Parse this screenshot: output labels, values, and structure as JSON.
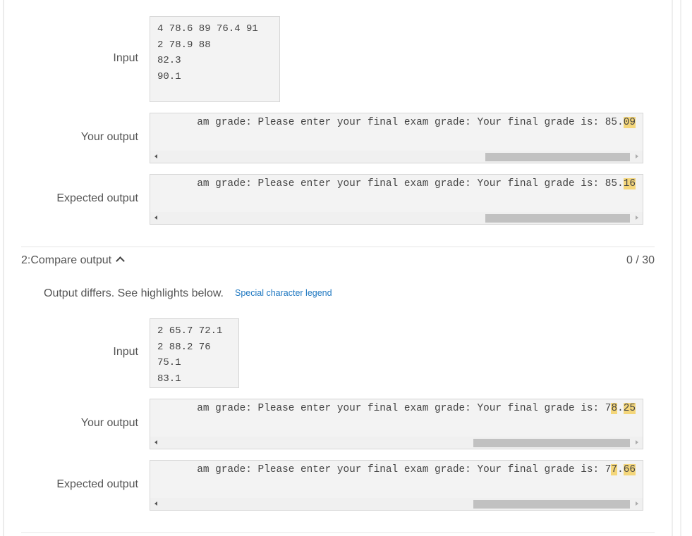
{
  "tests": [
    {
      "input": {
        "label": "Input",
        "value": "4 78.6 89 76.4 91\n2 78.9 88\n82.3\n90.1"
      },
      "your_output": {
        "label": "Your output",
        "prefix": "am grade: Please enter your final exam grade: Your final grade is: 85.",
        "diffs": [
          "09"
        ]
      },
      "expected_output": {
        "label": "Expected output",
        "prefix": "am grade: Please enter your final exam grade: Your final grade is: 85.",
        "diffs": [
          "16"
        ]
      }
    },
    {
      "header": {
        "title": "2:Compare output",
        "score": "0 / 30"
      },
      "message": "Output differs. See highlights below.",
      "legend_link": "Special character legend",
      "input": {
        "label": "Input",
        "value": "2 65.7 72.1\n2 88.2 76\n75.1\n83.1"
      },
      "your_output": {
        "label": "Your output",
        "prefix": "am grade: Please enter your final exam grade: Your final grade is: 7",
        "diff1": "8",
        "mid": ".",
        "diff2": "25"
      },
      "expected_output": {
        "label": "Expected output",
        "prefix": "am grade: Please enter your final exam grade: Your final grade is: 7",
        "diff1": "7",
        "mid": ".",
        "diff2": "66"
      }
    }
  ],
  "colors": {
    "highlight": "#f4d67a",
    "link": "#1f78c1"
  }
}
